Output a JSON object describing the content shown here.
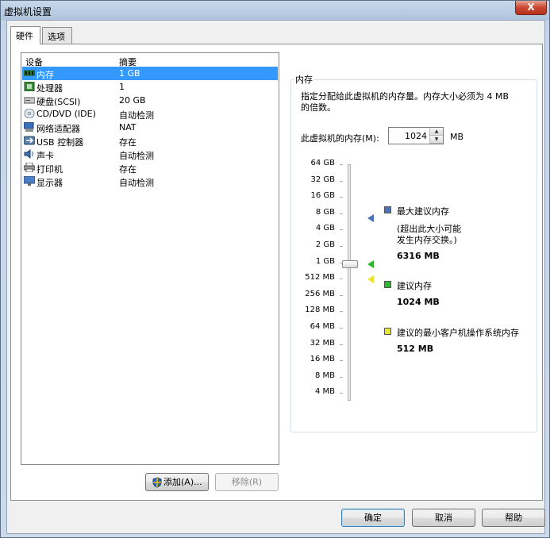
{
  "window": {
    "title": "虚拟机设置",
    "close": "X"
  },
  "tabs": [
    {
      "label": "硬件"
    },
    {
      "label": "选项"
    }
  ],
  "device_list": {
    "headers": {
      "device": "设备",
      "summary": "摘要"
    },
    "rows": [
      {
        "name": "内存",
        "summary": "1 GB",
        "icon": "memory-icon"
      },
      {
        "name": "处理器",
        "summary": "1",
        "icon": "processor-icon"
      },
      {
        "name": "硬盘(SCSI)",
        "summary": "20 GB",
        "icon": "hard-disk-icon"
      },
      {
        "name": "CD/DVD (IDE)",
        "summary": "自动检测",
        "icon": "cd-dvd-icon"
      },
      {
        "name": "网络适配器",
        "summary": "NAT",
        "icon": "network-adapter-icon"
      },
      {
        "name": "USB 控制器",
        "summary": "存在",
        "icon": "usb-icon"
      },
      {
        "name": "声卡",
        "summary": "自动检测",
        "icon": "sound-card-icon"
      },
      {
        "name": "打印机",
        "summary": "存在",
        "icon": "printer-icon"
      },
      {
        "name": "显示器",
        "summary": "自动检测",
        "icon": "display-icon"
      }
    ],
    "add_button": "添加(A)...",
    "remove_button": "移除(R)"
  },
  "memory": {
    "group_title": "内存",
    "description_line1": "指定分配给此虚拟机的内存量。内存大小必须为 4 MB",
    "description_line2": "的倍数。",
    "field_label": "此虚拟机的内存(M):",
    "value": "1024",
    "unit": "MB",
    "scale": [
      "64 GB",
      "32 GB",
      "16 GB",
      "8 GB",
      "4 GB",
      "2 GB",
      "1 GB",
      "512 MB",
      "256 MB",
      "128 MB",
      "64 MB",
      "32 MB",
      "16 MB",
      "8 MB",
      "4 MB"
    ],
    "legend": {
      "max_label": "最大建议内存",
      "max_note_line1": "(超出此大小可能",
      "max_note_line2": "发生内存交换。)",
      "max_value": "6316 MB",
      "recommended_label": "建议内存",
      "recommended_value": "1024 MB",
      "min_label": "建议的最小客户机操作系统内存",
      "min_value": "512 MB"
    },
    "colors": {
      "max": "#4a72b8",
      "recommended": "#2db82d",
      "min": "#e6e62e"
    }
  },
  "footer": {
    "ok": "确定",
    "cancel": "取消",
    "help": "帮助"
  }
}
